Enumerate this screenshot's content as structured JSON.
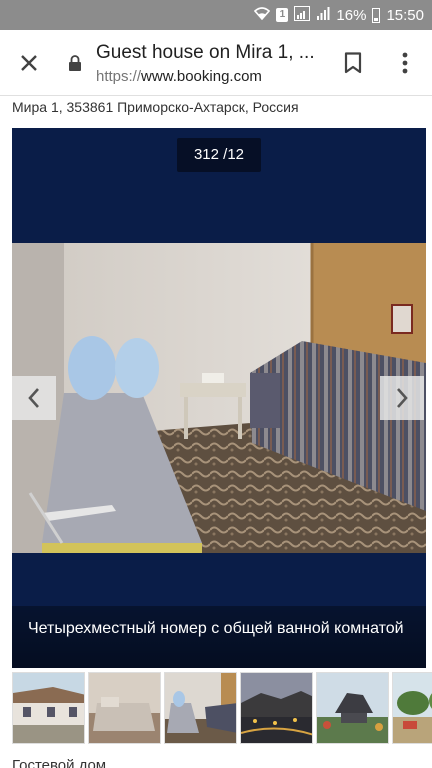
{
  "status_bar": {
    "sim_label": "1",
    "battery": "16%",
    "time": "15:50",
    "icons": [
      "wifi-icon",
      "sim-icon",
      "signal-icon",
      "signal-icon",
      "battery-icon"
    ]
  },
  "toolbar": {
    "page_title": "Guest house on Mira 1, ...",
    "url_scheme": "https://",
    "url_host": "www.booking.com",
    "icons": [
      "close-icon",
      "lock-icon",
      "bookmark-icon",
      "more-vert-icon"
    ]
  },
  "address": "Мира 1, 353861 Приморско-Ахтарск, Россия",
  "gallery": {
    "counter": "312 /12",
    "caption": "Четырехместный номер с общей ванной комнатой",
    "background_color": "#0a1d48",
    "icons": [
      "chevron-left-icon",
      "chevron-right-icon"
    ]
  },
  "thumbnails": [
    {
      "subject": "building-exterior"
    },
    {
      "subject": "bedroom"
    },
    {
      "subject": "bedroom-with-sofa"
    },
    {
      "subject": "city-night"
    },
    {
      "subject": "monument"
    },
    {
      "subject": "park"
    }
  ],
  "bottom_text": "Гостевой дом"
}
